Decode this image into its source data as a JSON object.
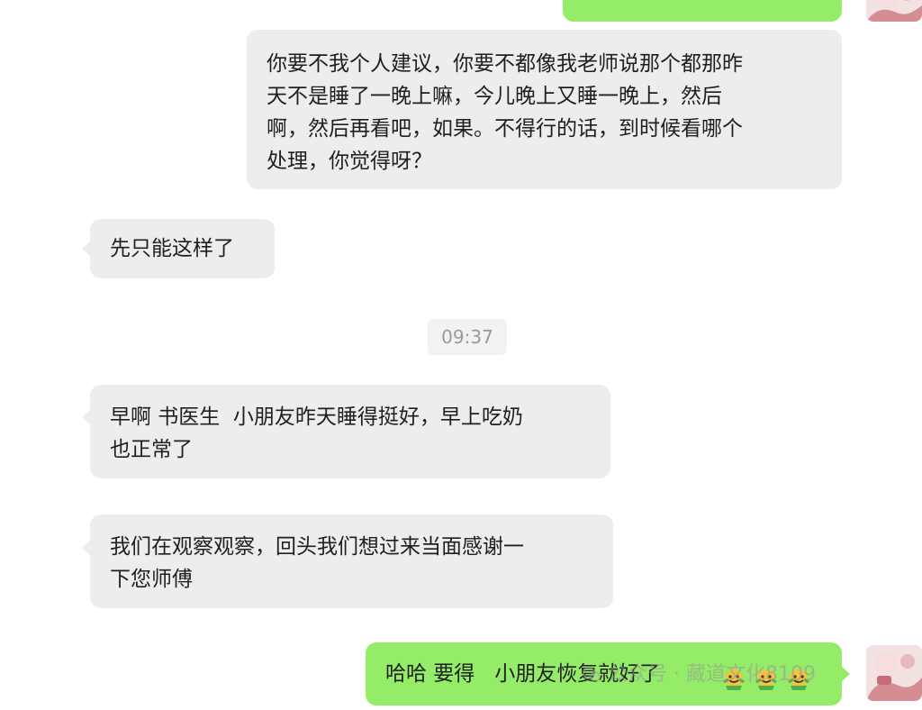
{
  "messages": [
    {
      "id": "top-outgoing",
      "text": "?"
    },
    {
      "id": "outgoing-suggestion",
      "lines": [
        "你要不我个人建议，你要不都像我老师说那个都那昨",
        "天不是睡了一晚上嘛，今儿晚上又睡一晚上，然后",
        "啊，然后再看吧，如果。不得行的话，到时候看哪个",
        "处理，你觉得呀？"
      ]
    },
    {
      "id": "incoming-only-this",
      "lines": [
        "先只能这样了"
      ]
    },
    {
      "id": "incoming-morning",
      "lines": [
        "早啊 书医生  小朋友昨天睡得挺好，早上吃奶",
        "也正常了"
      ]
    },
    {
      "id": "incoming-thanks",
      "lines": [
        "我们在观察观察，回头我们想过来当面感谢一",
        "下您师傅"
      ]
    },
    {
      "id": "outgoing-haha",
      "text": "哈哈 要得   小朋友恢复就好了"
    }
  ],
  "timestamp": "09:37",
  "emoji": {
    "name": "celebrate-emoji",
    "count": 3
  },
  "watermark": {
    "text": "公众号 · 藏道文化8109"
  },
  "colors": {
    "incoming_bubble": "#ededed",
    "outgoing_bubble": "#95ec69",
    "timestamp_text": "#9a9a9a"
  }
}
